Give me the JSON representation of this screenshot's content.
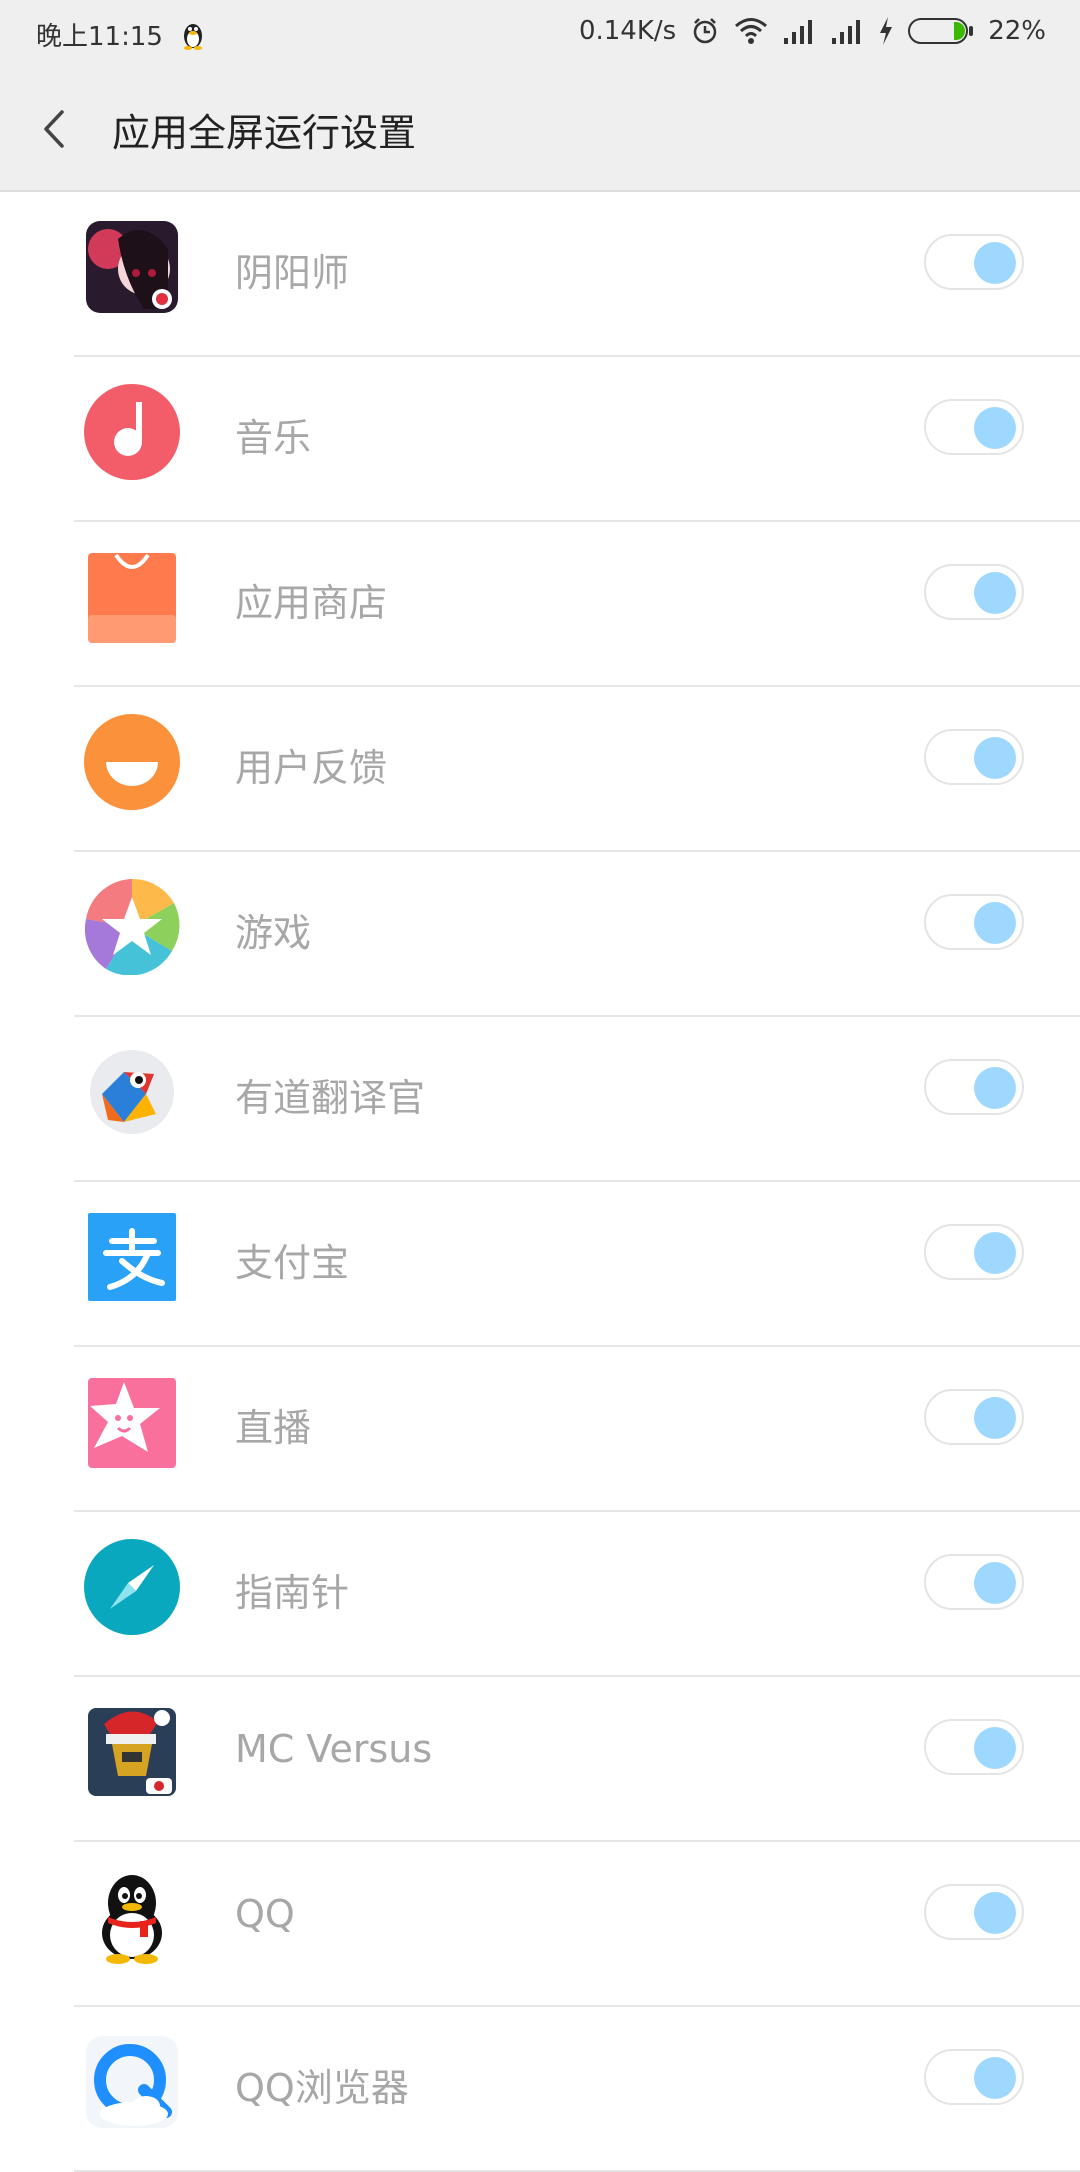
{
  "status": {
    "time": "晚上11:15",
    "speed": "0.14K/s",
    "battery": "22%"
  },
  "header": {
    "title": "应用全屏运行设置"
  },
  "apps": [
    {
      "label": "阴阳师",
      "icon": "onmyoji-icon",
      "on": true
    },
    {
      "label": "音乐",
      "icon": "music-icon",
      "on": true
    },
    {
      "label": "应用商店",
      "icon": "app-store-icon",
      "on": true
    },
    {
      "label": "用户反馈",
      "icon": "feedback-icon",
      "on": true
    },
    {
      "label": "游戏",
      "icon": "games-icon",
      "on": true
    },
    {
      "label": "有道翻译官",
      "icon": "youdao-icon",
      "on": true
    },
    {
      "label": "支付宝",
      "icon": "alipay-icon",
      "on": true
    },
    {
      "label": "直播",
      "icon": "live-icon",
      "on": true
    },
    {
      "label": "指南针",
      "icon": "compass-icon",
      "on": true
    },
    {
      "label": "MC Versus",
      "icon": "mc-versus-icon",
      "on": true
    },
    {
      "label": "QQ",
      "icon": "qq-icon",
      "on": true
    },
    {
      "label": "QQ浏览器",
      "icon": "qq-browser-icon",
      "on": true
    }
  ],
  "colors": {
    "toggle_on": "#9fd8ff",
    "label_gray": "#a7a7a7"
  }
}
